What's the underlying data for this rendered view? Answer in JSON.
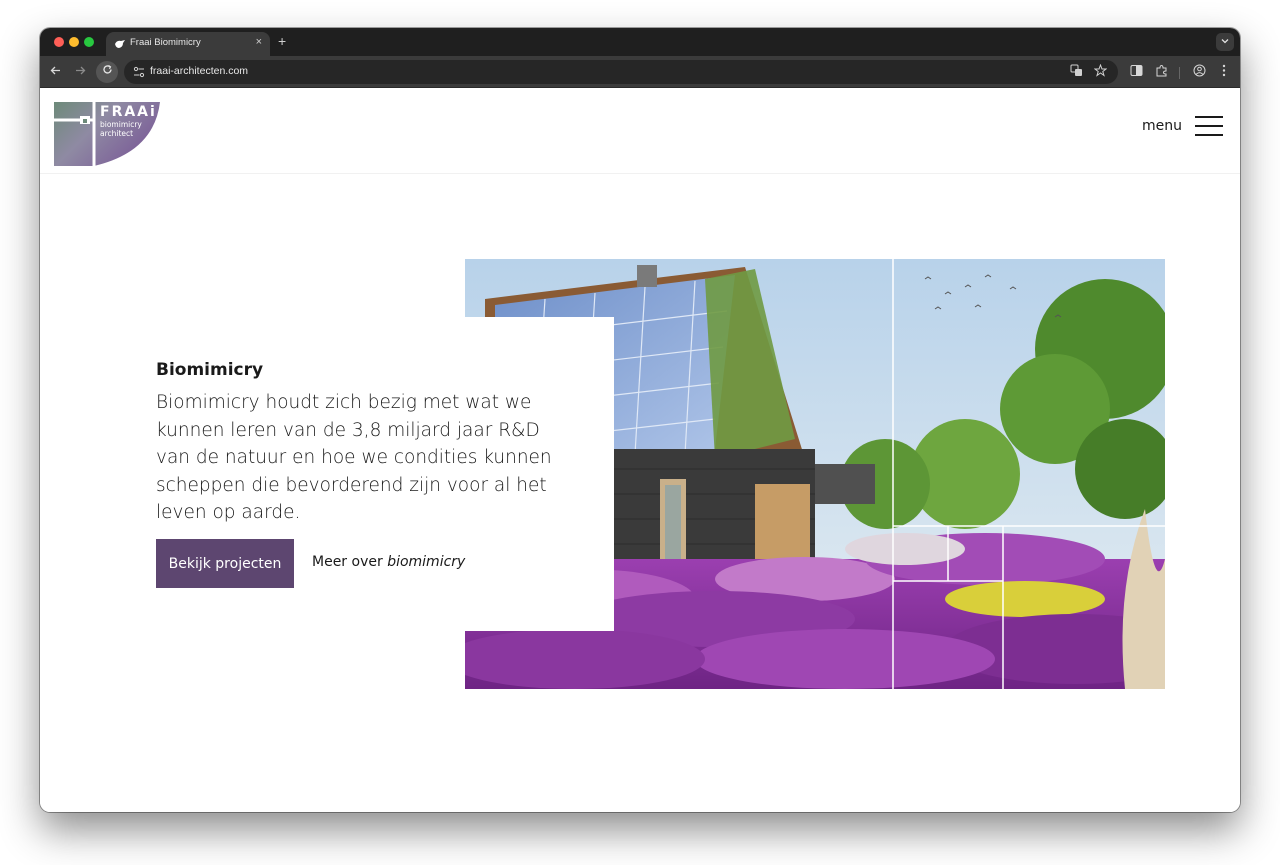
{
  "browser": {
    "tab_title": "Fraai Biomimicry",
    "tab_close": "×",
    "new_tab": "+",
    "url": "fraai-architecten.com"
  },
  "header": {
    "logo": {
      "brand": "FRAAi",
      "line1": "biomimicry",
      "line2": "architect"
    },
    "menu_label": "menu"
  },
  "hero": {
    "heading": "Biomimicry",
    "body": "Biomimicry houdt zich bezig met wat we kunnen leren van de 3,8 miljard jaar R&D van de natuur en hoe we condities kunnen scheppen die bevorderend zijn voor al het leven op aarde.",
    "primary_button": "Bekijk projecten",
    "secondary_link_prefix": "Meer over",
    "secondary_link_emphasis": "biomimicry"
  },
  "colors": {
    "accent": "#5d4670",
    "browser_chrome": "#3b3b3b",
    "tabstrip": "#1f1f1f"
  },
  "icons": {
    "favicon": "bird-icon",
    "site_info": "tune-icon",
    "translate": "translate-icon",
    "bookmark": "star-icon",
    "reading_mode": "reader-icon",
    "extensions": "puzzle-icon",
    "profile": "profile-icon",
    "menu": "hamburger-icon"
  }
}
